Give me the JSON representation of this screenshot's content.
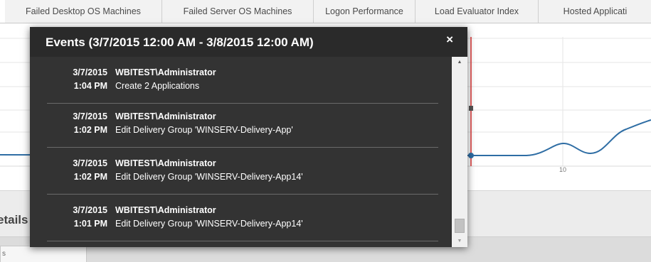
{
  "tabs": [
    {
      "label": "Failed Desktop OS Machines"
    },
    {
      "label": "Failed Server OS Machines"
    },
    {
      "label": "Logon Performance"
    },
    {
      "label": "Load Evaluator Index"
    },
    {
      "label": "Hosted Applicati"
    }
  ],
  "chart": {
    "x_tick_label": "10",
    "line_color": "#2e6da4",
    "marker_color": "#e03030"
  },
  "details": {
    "title": "etails",
    "tab_label": "s"
  },
  "events_popup": {
    "title": "Events (3/7/2015 12:00 AM - 3/8/2015 12:00 AM)",
    "close_label": "×",
    "events": [
      {
        "date": "3/7/2015",
        "time": "1:04 PM",
        "user": "WBITEST\\Administrator",
        "description": "Create 2 Applications"
      },
      {
        "date": "3/7/2015",
        "time": "1:02 PM",
        "user": "WBITEST\\Administrator",
        "description": "Edit Delivery Group 'WINSERV-Delivery-App'"
      },
      {
        "date": "3/7/2015",
        "time": "1:02 PM",
        "user": "WBITEST\\Administrator",
        "description": "Edit Delivery Group 'WINSERV-Delivery-App14'"
      },
      {
        "date": "3/7/2015",
        "time": "1:01 PM",
        "user": "WBITEST\\Administrator",
        "description": "Edit Delivery Group 'WINSERV-Delivery-App14'"
      }
    ],
    "scroll_up_icon": "▲",
    "scroll_down_icon": "▼"
  }
}
